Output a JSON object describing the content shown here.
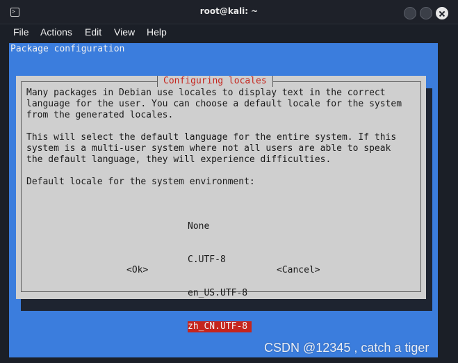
{
  "window": {
    "title": "root@kali: ~",
    "icon": "terminal-icon"
  },
  "menu": [
    "File",
    "Actions",
    "Edit",
    "View",
    "Help"
  ],
  "terminal": {
    "header": "Package configuration",
    "dialog": {
      "title": "Configuring locales",
      "body": "Many packages in Debian use locales to display text in the correct\nlanguage for the user. You can choose a default locale for the system\nfrom the generated locales.\n\nThis will select the default language for the entire system. If this\nsystem is a multi-user system where not all users are able to speak\nthe default language, they will experience difficulties.\n\nDefault locale for the system environment:",
      "options": [
        "None",
        "C.UTF-8",
        "en_US.UTF-8",
        "zh_CN.UTF-8"
      ],
      "selected_option": "zh_CN.UTF-8",
      "ok_label": "<Ok>",
      "cancel_label": "<Cancel>"
    }
  },
  "watermark": "CSDN @12345 , catch a tiger",
  "colors": {
    "terminal_bg": "#3b7ddd",
    "dialog_bg": "#cfcfcf",
    "accent_red": "#c5251d"
  }
}
